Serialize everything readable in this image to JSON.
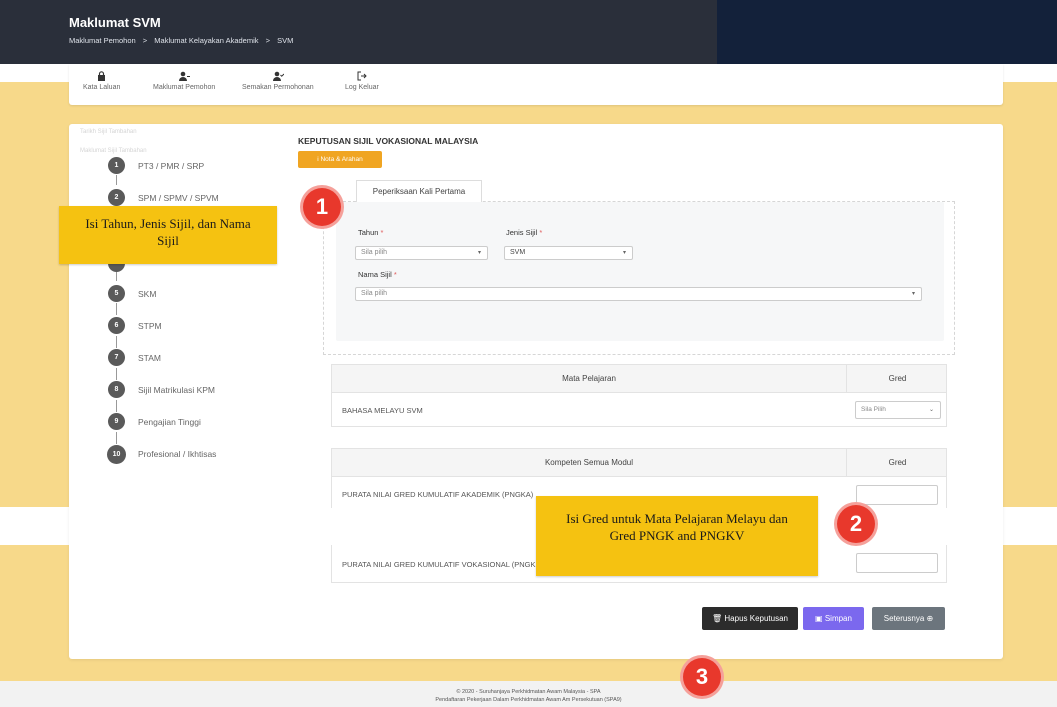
{
  "header": {
    "title": "Maklumat SVM",
    "breadcrumb": [
      "Maklumat Pemohon",
      ">",
      "Maklumat Kelayakan Akademik",
      ">",
      "SVM"
    ]
  },
  "nav": {
    "items": [
      {
        "label": "Kata Laluan",
        "icon": "lock-icon"
      },
      {
        "label": "Maklumat Pemohon",
        "icon": "user-icon"
      },
      {
        "label": "Semakan Permohonan",
        "icon": "user-check-icon"
      },
      {
        "label": "Log Keluar",
        "icon": "logout-icon"
      }
    ]
  },
  "sidebar": {
    "header1": "Tarikh Sijil Tambahan",
    "header2": "Maklumat Sijil Tambahan",
    "steps": [
      {
        "num": "1",
        "label": "PT3 / PMR / SRP"
      },
      {
        "num": "2",
        "label": "SPM / SPMV / SPVM"
      },
      {
        "num": "5",
        "label": "SKM"
      },
      {
        "num": "6",
        "label": "STPM"
      },
      {
        "num": "7",
        "label": "STAM"
      },
      {
        "num": "8",
        "label": "Sijil Matrikulasi KPM"
      },
      {
        "num": "9",
        "label": "Pengajian Tinggi"
      },
      {
        "num": "10",
        "label": "Profesional / Ikhtisas"
      }
    ]
  },
  "main": {
    "section_title": "KEPUTUSAN SIJIL VOKASIONAL MALAYSIA",
    "nota_button": "i Nota & Arahan",
    "tab": "Peperiksaan Kali Pertama",
    "form": {
      "tahun_label": "Tahun",
      "tahun_placeholder": "Sila pilih",
      "jenis_label": "Jenis Sijil",
      "jenis_value": "SVM",
      "nama_label": "Nama Sijil",
      "nama_placeholder": "Sila pilih",
      "required_mark": "*"
    },
    "table1": {
      "header_subject": "Mata Pelajaran",
      "header_gred": "Gred",
      "row_label": "BAHASA MELAYU SVM",
      "row_select": "Sila Pilih"
    },
    "table2": {
      "header_subject": "Kompeten Semua Modul",
      "header_gred": "Gred",
      "row1_label": "PURATA NILAI GRED KUMULATIF AKADEMIK (PNGKA)",
      "row2_label": "PURATA NILAI GRED KUMULATIF VOKASIONAL (PNGK"
    },
    "buttons": {
      "hapus": "Hapus Keputusan",
      "simpan": "Simpan",
      "seterusnya": "Seterusnya"
    }
  },
  "annotations": {
    "note1": "Isi Tahun, Jenis Sijil, dan Nama Sijil",
    "note2": "Isi Gred untuk Mata Pelajaran Melayu dan Gred PNGK and PNGKV",
    "badge1": "1",
    "badge2": "2",
    "badge3": "3"
  },
  "footer": {
    "line1": "© 2020 - Suruhanjaya Perkhidmatan Awam Malaysia - SPA",
    "line2": "Pendaftaran Pekerjaan Dalam Perkhidmatan Awam Am Persekutuan (SPA9)"
  },
  "colors": {
    "header_bg": "#2a2f3a",
    "accent_yellow": "#f5c211",
    "badge_red": "#e8382c",
    "simpan_purple": "#7b68ee",
    "hapus_dark": "#2c2c2c",
    "seterusnya_gray": "#6c757d"
  }
}
